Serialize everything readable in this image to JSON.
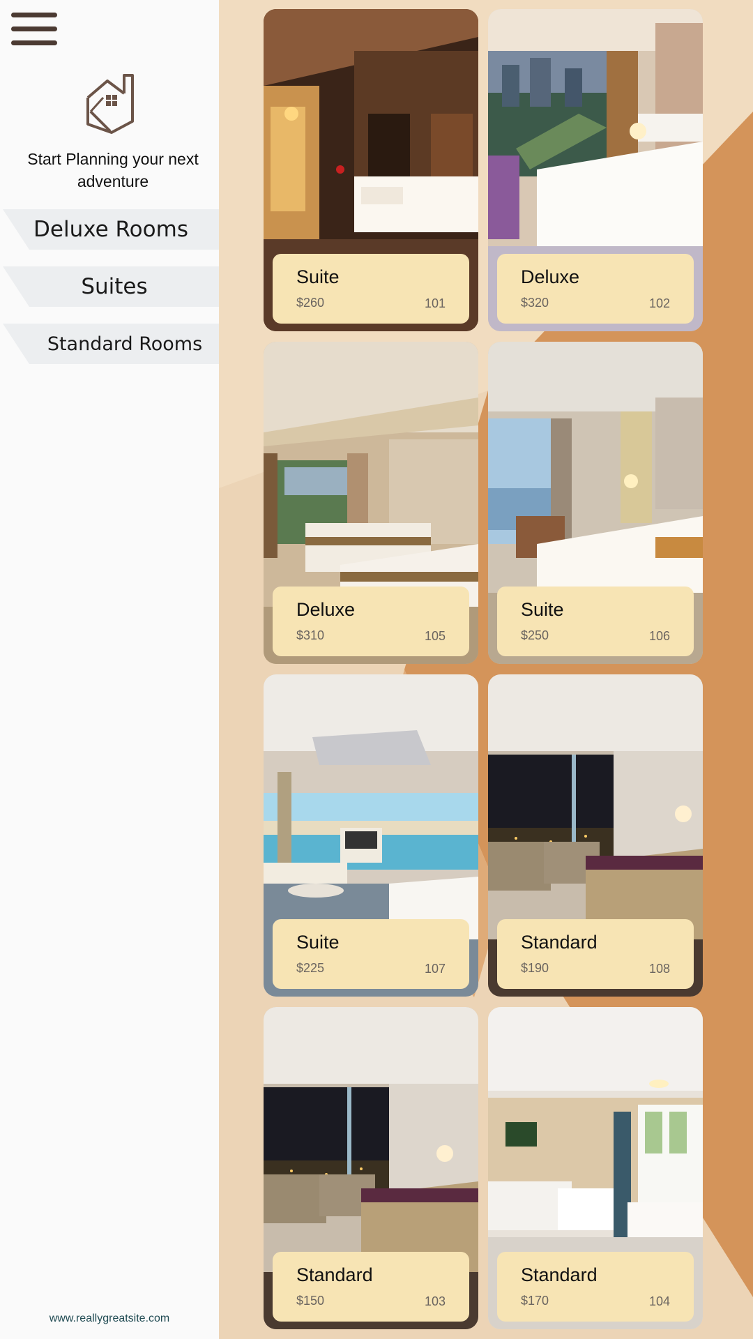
{
  "sidebar": {
    "tagline": "Start Planning your next adventure",
    "nav": [
      "Deluxe Rooms",
      "Suites",
      "Standard Rooms"
    ],
    "website": "www.reallygreatsite.com",
    "icons": {
      "menu": "hamburger-menu-icon",
      "logo": "house-logo-icon"
    }
  },
  "rooms": [
    {
      "type": "Suite",
      "price": "$260",
      "number": "101"
    },
    {
      "type": "Deluxe",
      "price": "$320",
      "number": "102"
    },
    {
      "type": "Deluxe",
      "price": "$310",
      "number": "105"
    },
    {
      "type": "Suite",
      "price": "$250",
      "number": "106"
    },
    {
      "type": "Suite",
      "price": "$225",
      "number": "107"
    },
    {
      "type": "Standard",
      "price": "$190",
      "number": "108"
    },
    {
      "type": "Standard",
      "price": "$150",
      "number": "103"
    },
    {
      "type": "Standard",
      "price": "$170",
      "number": "104"
    }
  ],
  "colors": {
    "background": "#ecd4b6",
    "accent": "#d4945a",
    "card_info": "#f7e4b4",
    "sidebar": "#fafafa",
    "nav_item": "#eceef0",
    "dark": "#4b3a32"
  }
}
